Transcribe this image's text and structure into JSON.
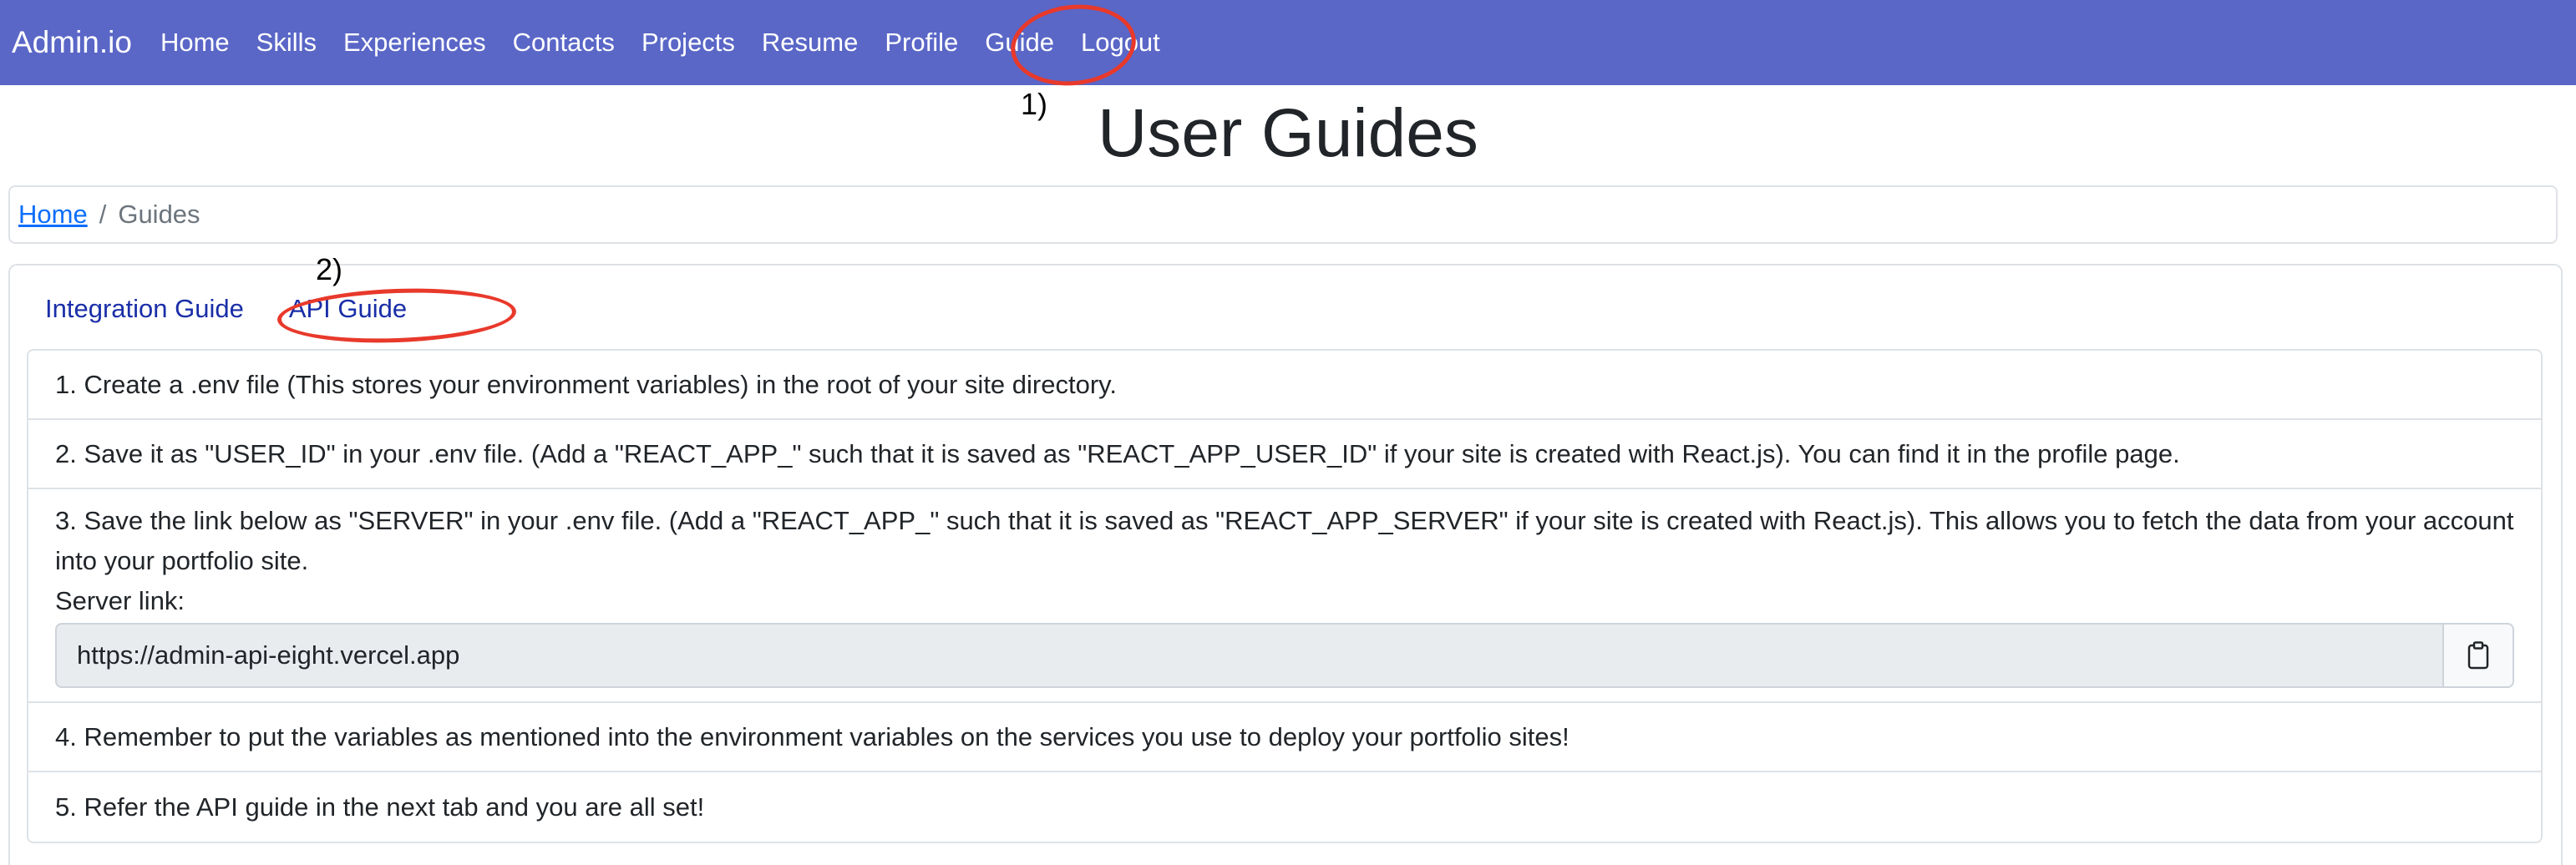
{
  "navbar": {
    "brand": "Admin.io",
    "links": [
      "Home",
      "Skills",
      "Experiences",
      "Contacts",
      "Projects",
      "Resume",
      "Profile",
      "Guide",
      "Logout"
    ]
  },
  "annotations": {
    "step1": "1)",
    "step2": "2)",
    "circle_color": "#e8392b"
  },
  "page": {
    "title": "User Guides"
  },
  "breadcrumb": {
    "home": "Home",
    "separator": "/",
    "current": "Guides"
  },
  "tabs": [
    "Integration Guide",
    "API Guide"
  ],
  "steps": {
    "s1": "1. Create a .env file (This stores your environment variables) in the root of your site directory.",
    "s2": "2. Save it as \"USER_ID\" in your .env file. (Add a \"REACT_APP_\" such that it is saved as \"REACT_APP_USER_ID\" if your site is created with React.js). You can find it in the profile page.",
    "s3": "3. Save the link below as \"SERVER\" in your .env file. (Add a \"REACT_APP_\" such that it is saved as \"REACT_APP_SERVER\" if your site is created with React.js). This allows you to fetch the data from your account into your portfolio site.",
    "server_label": "Server link:",
    "server_value": "https://admin-api-eight.vercel.app",
    "copy_icon": "clipboard-icon",
    "s4": "4. Remember to put the variables as mentioned into the environment variables on the services you use to deploy your portfolio sites!",
    "s5": "5. Refer the API guide in the next tab and you are all set!"
  },
  "colors": {
    "navbar": "#5a67c7",
    "link": "#0d6efd",
    "tab": "#1a2ea8"
  }
}
